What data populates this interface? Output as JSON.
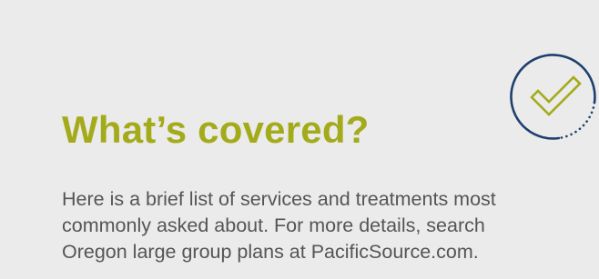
{
  "section": {
    "title": "What’s covered?",
    "intro_lines": [
      "Here is a brief list of services and treatments most",
      "commonly asked about. For more details, search",
      "Oregon large group plans at PacificSource.com."
    ]
  },
  "icons": {
    "badge": "checkmark-circle-icon"
  },
  "colors": {
    "title": "#a4ab1b",
    "circle": "#1f3f6e",
    "check": "#a4ab1b",
    "body_text": "#555555",
    "background": "#ebebeb"
  }
}
